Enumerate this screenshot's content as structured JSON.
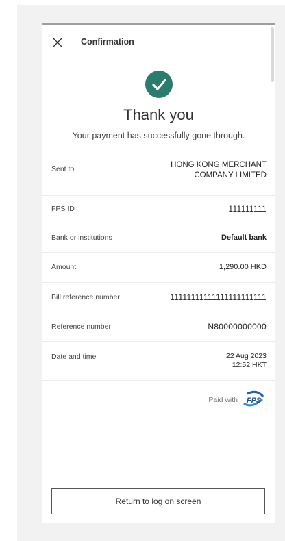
{
  "header": {
    "title": "Confirmation"
  },
  "status": {
    "heading": "Thank you",
    "message": "Your payment has successfully gone through.",
    "accent_color": "#2a7d6e"
  },
  "details": [
    {
      "label": "Sent to",
      "value_line1": "HONG KONG MERCHANT",
      "value_line2": "COMPANY LIMITED"
    },
    {
      "label": "FPS ID",
      "value": "111111111"
    },
    {
      "label": "Bank or institutions",
      "value": "Default bank"
    },
    {
      "label": "Amount",
      "value": "1,290.00 HKD"
    },
    {
      "label": "Bill reference number",
      "value": "11111111111111111111111"
    },
    {
      "label": "Reference number",
      "value": "N80000000000"
    },
    {
      "label": "Date and time",
      "value_line1": "22 Aug 2023",
      "value_line2": "12:52 HKT"
    }
  ],
  "paid_with": {
    "label": "Paid with",
    "logo_text": "FPS"
  },
  "footer": {
    "button_label": "Return to log on screen"
  }
}
